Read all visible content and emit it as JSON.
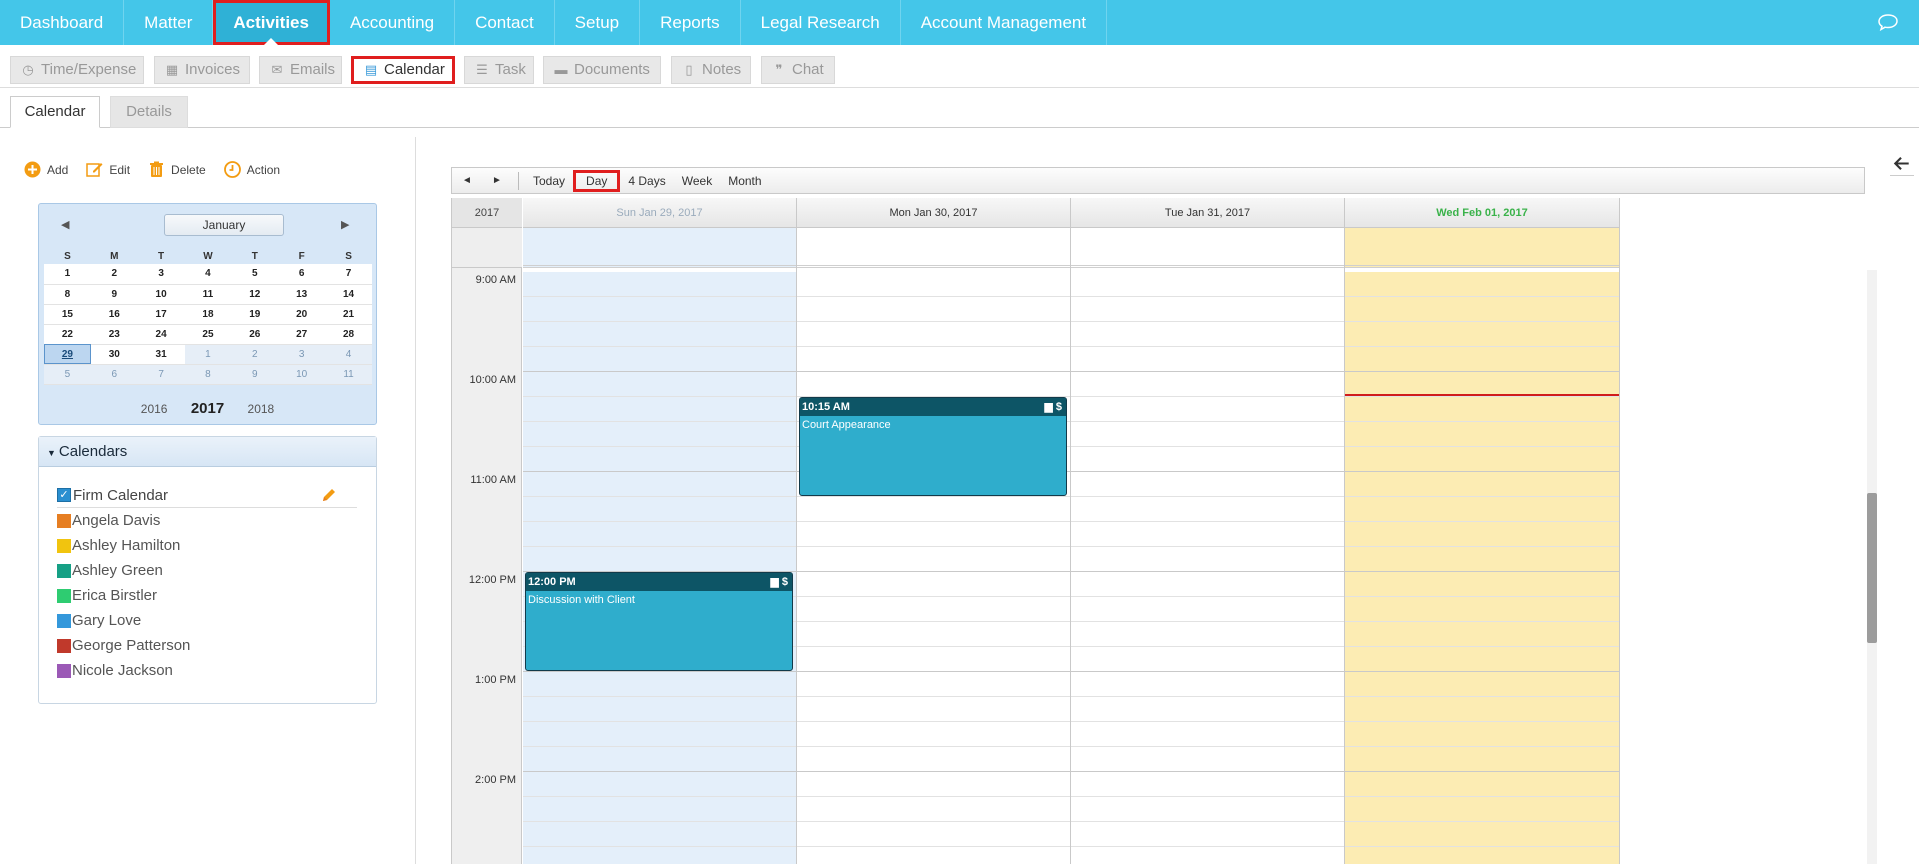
{
  "topnav": {
    "items": [
      {
        "label": "Dashboard"
      },
      {
        "label": "Matter"
      },
      {
        "label": "Activities",
        "active": true
      },
      {
        "label": "Accounting"
      },
      {
        "label": "Contact"
      },
      {
        "label": "Setup"
      },
      {
        "label": "Reports"
      },
      {
        "label": "Legal Research"
      },
      {
        "label": "Account Management"
      }
    ],
    "chat_icon": "speech-bubble-icon",
    "color": "#44c6e9"
  },
  "subnav": {
    "items": [
      {
        "label": "Time/Expense",
        "icon": "clock-icon"
      },
      {
        "label": "Invoices",
        "icon": "calculator-icon"
      },
      {
        "label": "Emails",
        "icon": "envelope-icon"
      },
      {
        "label": "Calendar",
        "icon": "calendar-icon",
        "active": true
      },
      {
        "label": "Task",
        "icon": "list-icon"
      },
      {
        "label": "Documents",
        "icon": "folder-icon"
      },
      {
        "label": "Notes",
        "icon": "note-icon"
      },
      {
        "label": "Chat",
        "icon": "chat-icon"
      }
    ]
  },
  "tabs": {
    "calendar": "Calendar",
    "details": "Details"
  },
  "actions": {
    "add": "Add",
    "edit": "Edit",
    "delete": "Delete",
    "action": "Action"
  },
  "minical": {
    "month": "January",
    "weekdays": [
      "S",
      "M",
      "T",
      "W",
      "T",
      "F",
      "S"
    ],
    "weeks": [
      [
        "1",
        "2",
        "3",
        "4",
        "5",
        "6",
        "7"
      ],
      [
        "8",
        "9",
        "10",
        "11",
        "12",
        "13",
        "14"
      ],
      [
        "15",
        "16",
        "17",
        "18",
        "19",
        "20",
        "21"
      ],
      [
        "22",
        "23",
        "24",
        "25",
        "26",
        "27",
        "28"
      ],
      [
        "29",
        "30",
        "31",
        "1",
        "2",
        "3",
        "4"
      ],
      [
        "5",
        "6",
        "7",
        "8",
        "9",
        "10",
        "11"
      ]
    ],
    "selected": "29",
    "years": {
      "prev": "2016",
      "current": "2017",
      "next": "2018"
    }
  },
  "calendars": {
    "title": "Calendars",
    "items": [
      {
        "name": "Firm Calendar",
        "checked": true,
        "color": "#2a8fd0"
      },
      {
        "name": "Angela Davis",
        "color": "#e67e22"
      },
      {
        "name": "Ashley Hamilton",
        "color": "#f1c40f"
      },
      {
        "name": "Ashley Green",
        "color": "#16a085"
      },
      {
        "name": "Erica Birstler",
        "color": "#2ecc71"
      },
      {
        "name": "Gary Love",
        "color": "#3498db"
      },
      {
        "name": "George Patterson",
        "color": "#c0392b"
      },
      {
        "name": "Nicole Jackson",
        "color": "#9b59b6"
      }
    ]
  },
  "toolbar": {
    "prev": "◄",
    "next": "►",
    "today": "Today",
    "day": "Day",
    "four_days": "4 Days",
    "week": "Week",
    "month": "Month"
  },
  "schedule": {
    "year": "2017",
    "days": [
      {
        "label": "Sun Jan 29, 2017",
        "state": "past"
      },
      {
        "label": "Mon Jan 30, 2017",
        "state": "normal"
      },
      {
        "label": "Tue Jan 31, 2017",
        "state": "normal"
      },
      {
        "label": "Wed Feb 01, 2017",
        "state": "today"
      }
    ],
    "times": [
      "9:00 AM",
      "10:00 AM",
      "11:00 AM",
      "12:00 PM",
      "1:00 PM",
      "2:00 PM"
    ],
    "events": [
      {
        "day": 1,
        "time": "10:15 AM",
        "title": "Court Appearance",
        "start": 10.25,
        "end": 11.25,
        "icons": "▆ $"
      },
      {
        "day": 0,
        "time": "12:00 PM",
        "title": "Discussion with Client",
        "start": 12.0,
        "end": 13.0,
        "icons": "▆ $"
      }
    ],
    "current_time": 10.25,
    "colors": {
      "past_bg": "#e4effa",
      "today_bg": "#fcecb3",
      "event": "#2fadcc",
      "event_head": "#0d5566"
    }
  }
}
